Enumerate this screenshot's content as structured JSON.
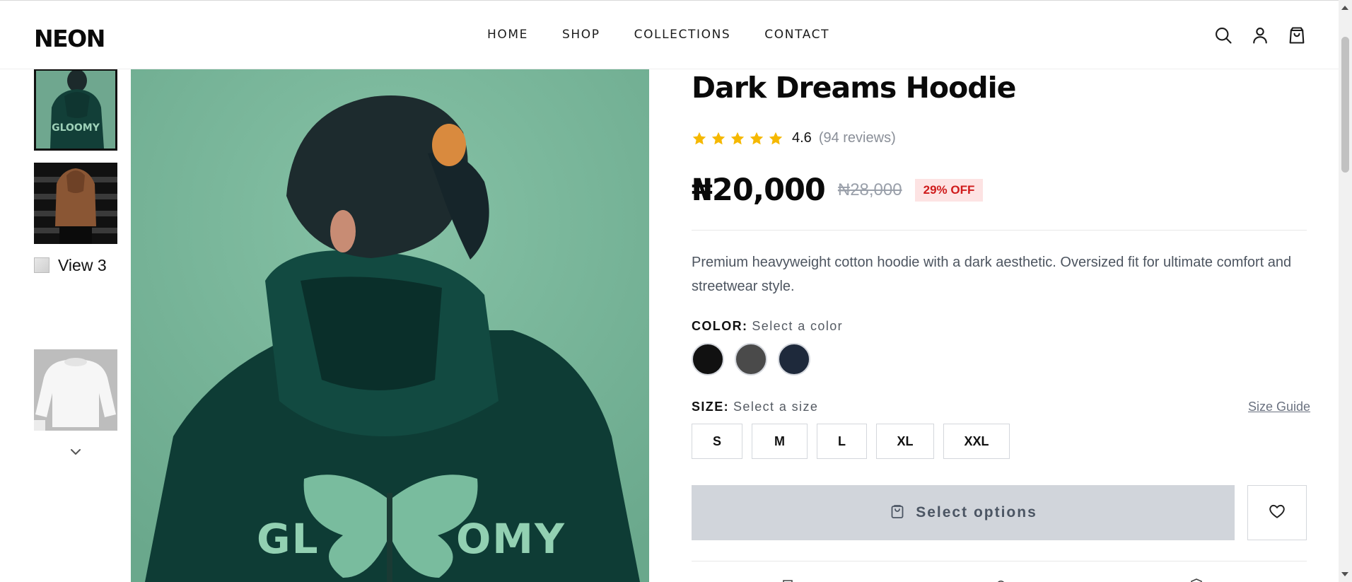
{
  "header": {
    "logo": "NEON",
    "nav": [
      "HOME",
      "SHOP",
      "COLLECTIONS",
      "CONTACT"
    ],
    "icons": [
      "search-icon",
      "user-icon",
      "shopping-bag-icon"
    ]
  },
  "gallery": {
    "thumbnails": [
      {
        "alt": "",
        "selected": true
      },
      {
        "alt": "",
        "selected": false
      },
      {
        "alt": "View 3",
        "selected": false
      },
      {
        "alt": "",
        "selected": false
      }
    ],
    "main_print_text": "GLOOMY"
  },
  "product": {
    "title": "Dark Dreams Hoodie",
    "rating": 4.6,
    "rating_value": "4.6",
    "reviews": "(94 reviews)",
    "price": "₦20,000",
    "old_price": "₦28,000",
    "discount": "29% OFF",
    "description": "Premium heavyweight cotton hoodie with a dark aesthetic. Oversized fit for ultimate comfort and streetwear style.",
    "color_label": "COLOR:",
    "color_prompt": "Select a color",
    "colors": [
      "#111111",
      "#4a4a4a",
      "#1e293b"
    ],
    "size_label": "SIZE:",
    "size_prompt": "Select a size",
    "size_guide": "Size Guide",
    "sizes": [
      "S",
      "M",
      "L",
      "XL",
      "XXL"
    ],
    "cta": "Select options"
  },
  "colors": {
    "accent_star": "#f5b800",
    "badge_bg": "#fde3e3",
    "badge_text": "#cf1b1b",
    "cta_bg": "#d1d5db"
  }
}
